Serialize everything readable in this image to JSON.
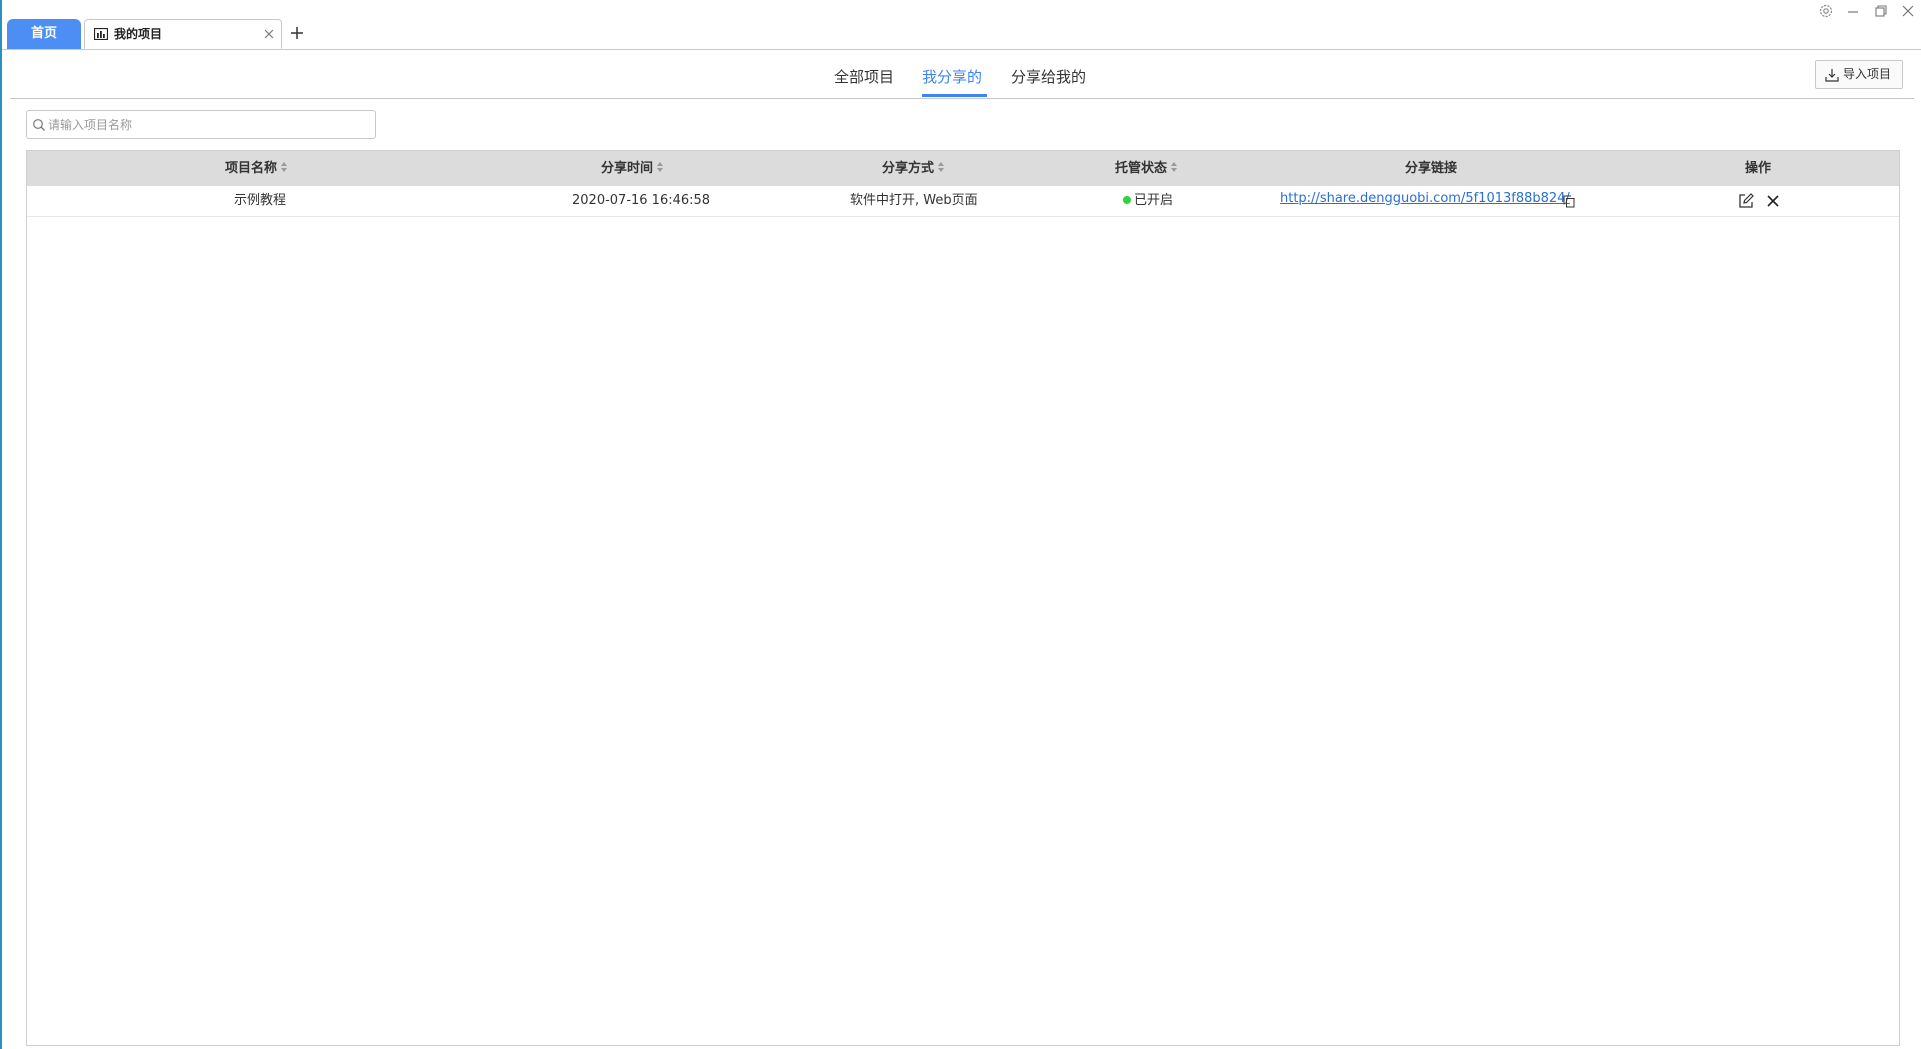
{
  "tabs": {
    "home_label": "首页",
    "doc_label": "我的项目"
  },
  "subnav": {
    "items": [
      {
        "label": "全部项目",
        "active": false
      },
      {
        "label": "我分享的",
        "active": true
      },
      {
        "label": "分享给我的",
        "active": false
      }
    ],
    "import_label": "导入项目"
  },
  "search": {
    "placeholder": "请输入项目名称",
    "value": ""
  },
  "table": {
    "columns": [
      {
        "label": "项目名称",
        "sortable": true
      },
      {
        "label": "分享时间",
        "sortable": true
      },
      {
        "label": "分享方式",
        "sortable": true
      },
      {
        "label": "托管状态",
        "sortable": true
      },
      {
        "label": "分享链接",
        "sortable": false
      },
      {
        "label": "操作",
        "sortable": false
      }
    ],
    "rows": [
      {
        "name": "示例教程",
        "time": "2020-07-16 16:46:58",
        "method": "软件中打开, Web页面",
        "status": "已开启",
        "link": "http://share.dengguobi.com/5f1013f88b824/"
      }
    ]
  },
  "colors": {
    "accent": "#3d85f0",
    "home_tab": "#4d8ef5",
    "status_on": "#2bd63a",
    "link": "#2a6fd1",
    "header_bg": "#dcdcdc"
  },
  "icons": {
    "tab": "chart-icon",
    "close": "close-icon",
    "add": "plus-icon",
    "settings": "gear-icon",
    "minimize": "minimize-icon",
    "restore": "restore-icon",
    "window_close": "window-close-icon",
    "import": "download-icon",
    "search": "search-icon",
    "sort": "sort-icon",
    "copy": "copy-icon",
    "edit": "edit-icon",
    "delete": "delete-icon"
  }
}
